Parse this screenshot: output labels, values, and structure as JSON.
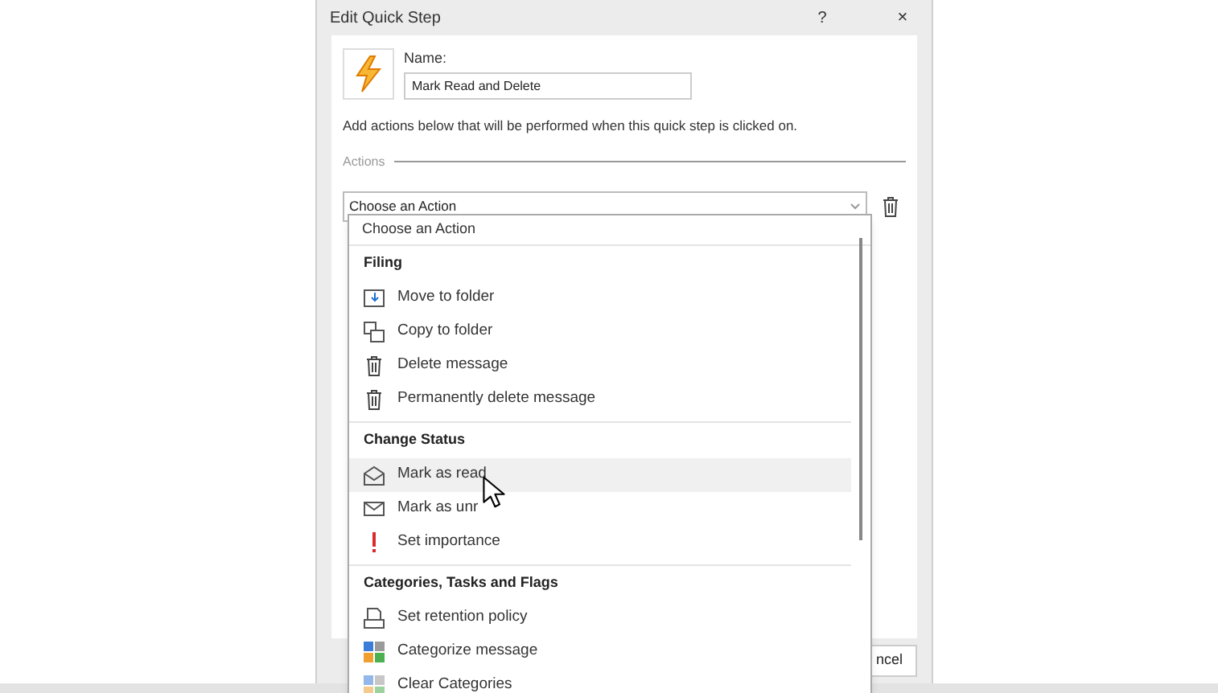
{
  "dialog": {
    "title": "Edit Quick Step",
    "help": "?",
    "close": "×",
    "name_label": "Name:",
    "name_value": "Mark Read and Delete",
    "description": "Add actions below that will be performed when this quick step is clicked on.",
    "actions_legend": "Actions",
    "action_select": "Choose an Action",
    "cancel_button": "ncel"
  },
  "dropdown": {
    "header": "Choose an Action",
    "groups": [
      {
        "title": "Filing",
        "items": [
          {
            "label": "Move to folder",
            "selected": false
          },
          {
            "label": "Copy to folder",
            "selected": false
          },
          {
            "label": "Delete message",
            "selected": false
          },
          {
            "label": "Permanently delete message",
            "selected": false
          }
        ]
      },
      {
        "title": "Change Status",
        "items": [
          {
            "label": "Mark as read",
            "selected": true
          },
          {
            "label": "Mark as unr",
            "selected": false
          },
          {
            "label": "Set importance",
            "selected": false
          }
        ]
      },
      {
        "title": "Categories, Tasks and Flags",
        "items": [
          {
            "label": "Set retention policy",
            "selected": false
          },
          {
            "label": "Categorize message",
            "selected": false
          },
          {
            "label": "Clear Categories",
            "selected": false
          }
        ]
      }
    ]
  }
}
